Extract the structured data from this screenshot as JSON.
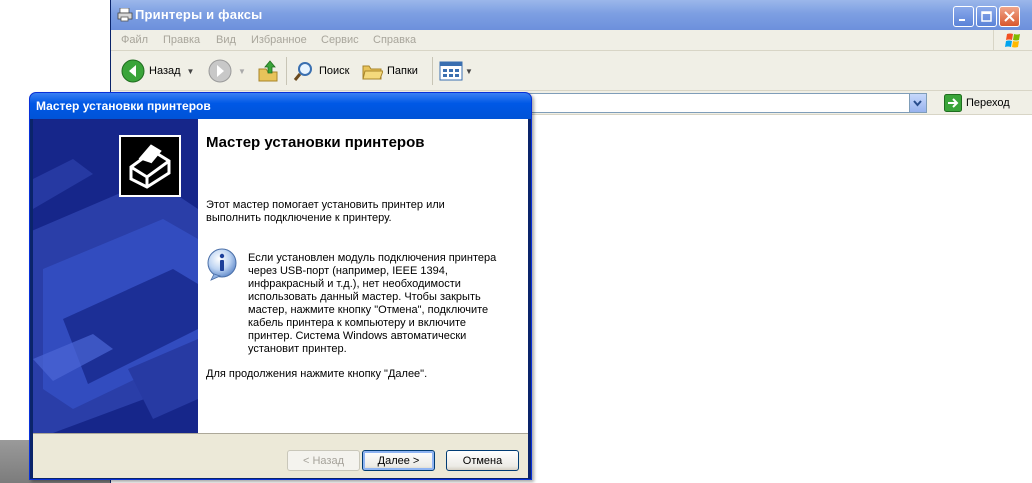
{
  "explorer": {
    "title": "Принтеры и факсы",
    "menu": [
      "Файл",
      "Правка",
      "Вид",
      "Избранное",
      "Сервис",
      "Справка"
    ],
    "toolbar": {
      "back": "Назад",
      "search": "Поиск",
      "folders": "Папки"
    },
    "address": {
      "value": "",
      "go": "Переход"
    },
    "icons": {
      "title": "printer-icon",
      "back": "back-arrow-icon",
      "forward": "forward-arrow-icon",
      "up": "up-folder-icon",
      "search": "search-icon",
      "folders": "folders-icon",
      "views": "views-icon",
      "go": "go-arrow-icon",
      "flag": "windows-flag-icon"
    }
  },
  "wizard": {
    "title": "Мастер установки принтеров",
    "heading": "Мастер установки принтеров",
    "intro": "Этот мастер помогает установить принтер или выполнить подключение к принтеру.",
    "info": "Если установлен модуль подключения принтера через USB-порт (например, IEEE 1394, инфракрасный и т.д.), нет необходимости использовать данный мастер. Чтобы закрыть мастер, нажмите кнопку \"Отмена\", подключите кабель принтера к компьютеру и включите принтер. Система Windows автоматически установит принтер.",
    "continue": "Для продолжения нажмите кнопку \"Далее\".",
    "buttons": {
      "back": "< Назад",
      "next": "Далее >",
      "cancel": "Отмена"
    },
    "icons": {
      "wizard": "printer-wizard-icon",
      "info": "info-icon"
    }
  },
  "colors": {
    "xp_blue": "#0058e6",
    "wizard_side": "#1a2b8c",
    "dialog_face": "#ece9d8"
  }
}
